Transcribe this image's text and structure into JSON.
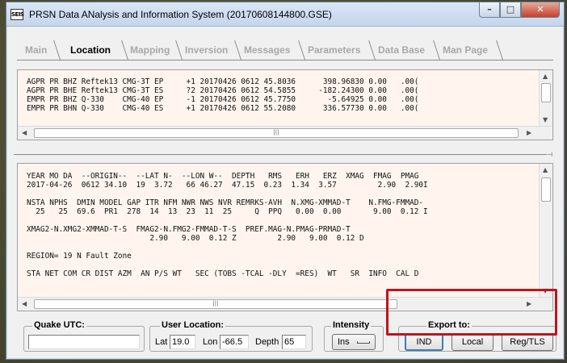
{
  "window": {
    "title": "PRSN Data ANalysis and Information System (20170608144800.GSE)",
    "icon_text": "SEIS"
  },
  "tabs": [
    "Main",
    "Location",
    "Mapping",
    "Inversion",
    "Messages",
    "Parameters",
    "Data Base",
    "Man Page"
  ],
  "active_tab": "Location",
  "phase_lines": [
    "AGPR PR BHZ Reftek13 CMG-3T EP     +1 20170426 0612 45.8036      398.96830 0.00   .00(",
    "AGPR PR BHE Reftek13 CMG-3T ES     ?2 20170426 0612 54.5855     -182.24300 0.00   .00(",
    "EMPR PR BHZ Q-330    CMG-40 EP     -1 20170426 0612 45.7750       -5.64925 0.00   .00(",
    "EMPR PR BHN Q-330    CMG-40 ES     +1 20170426 0612 55.2080      336.57730 0.00   .00("
  ],
  "location_lines": [
    "YEAR MO DA  --ORIGIN--  --LAT N-  --LON W--  DEPTH   RMS   ERH   ERZ  XMAG  FMAG  PMAG",
    "2017-04-26  0612 34.10  19  3.72   66 46.27  47.15  0.23  1.34  3.57         2.90  2.90I",
    "",
    "NSTA NPHS  DMIN MODEL GAP ITR NFM NWR NWS NVR REMRKS-AVH  N.XMG-XMMAD-T    N.FMG-FMMAD-",
    "  25   25  69.6  PR1  278  14  13  23  11  25     Q  PPQ   0.00  0.00       9.00  0.12 I",
    "",
    "XMAG2-N.XMG2-XMMAD-T-S  FMAG2-N.FMG2-FMMAD-T-S  PREF.MAG-N.PMAG-PRMAD-T",
    "                           2.90   9.00  0.12 Z         2.90   9.00  0.12 D",
    "",
    "REGION= 19 N Fault Zone",
    "",
    "STA NET COM CR DIST AZM  AN P/S WT   SEC (TOBS -TCAL -DLY  =RES)  WT   SR  INFO  CAL D"
  ],
  "quake_utc": {
    "label": "Quake UTC:",
    "value": ""
  },
  "user_location": {
    "label": "User Location:",
    "lat_label": "Lat",
    "lat": "19.0",
    "lon_label": "Lon",
    "lon": "-66.5",
    "depth_label": "Depth",
    "depth": "65"
  },
  "intensity": {
    "label": "Intensity",
    "value": "Ins"
  },
  "export": {
    "label": "Export to:",
    "buttons": [
      "IND",
      "Local",
      "Reg/TLS"
    ]
  },
  "colors": {
    "highlight": "#c0141c",
    "pane_bg": "#fff5ee",
    "active_tab": "#000000",
    "inactive_tab": "#a8a8a8"
  }
}
